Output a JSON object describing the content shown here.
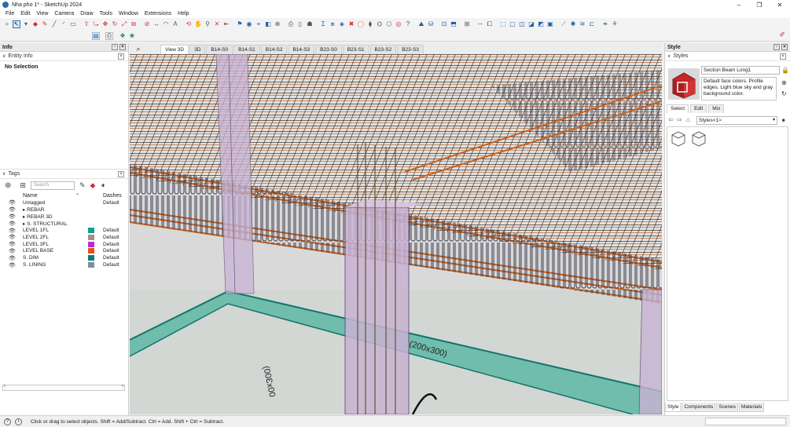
{
  "window": {
    "title": "Nha pho 1* - SketchUp 2024",
    "minimize": "–",
    "restore": "❐",
    "close": "✕"
  },
  "menu": [
    "File",
    "Edit",
    "View",
    "Camera",
    "Draw",
    "Tools",
    "Window",
    "Extensions",
    "Help"
  ],
  "left_panel": {
    "title": "Info",
    "entity_info": {
      "header": "Entity Info",
      "value": "No Selection"
    },
    "tags": {
      "header": "Tags",
      "search_placeholder": "Search",
      "col_name": "Name",
      "col_dashes": "Dashes",
      "rows": [
        {
          "name": "Untagged",
          "dash": "Default",
          "color": ""
        },
        {
          "name": "▸ REBAR",
          "dash": "",
          "color": ""
        },
        {
          "name": "▸ REBAR 3D",
          "dash": "",
          "color": ""
        },
        {
          "name": "▸ S. STRUCTURAL",
          "dash": "",
          "color": ""
        },
        {
          "name": "LEVEL 1FL",
          "dash": "Default",
          "color": "#14a08c"
        },
        {
          "name": "LEVEL 2FL",
          "dash": "Default",
          "color": "#a88b8b"
        },
        {
          "name": "LEVEL 3FL",
          "dash": "Default",
          "color": "#b52cde"
        },
        {
          "name": "LEVEL BASE",
          "dash": "Default",
          "color": "#e2531c"
        },
        {
          "name": "S. DIM",
          "dash": "Default",
          "color": "#117a7a"
        },
        {
          "name": "S. LINING",
          "dash": "Default",
          "color": "#7c8fa3"
        }
      ]
    }
  },
  "scene_tabs": [
    "View 3D",
    "3D",
    "B14-S0",
    "B14-S1",
    "B14-S2",
    "B14-S3",
    "B23-S0",
    "B23-S1",
    "B23-S2",
    "B23-S3"
  ],
  "viewport": {
    "dim_label_1": "(200x300)",
    "dim_label_2": "(00Ɛx00"
  },
  "right_panel": {
    "title": "Style",
    "styles_header": "Styles",
    "style_name": "Section Beam Long1",
    "style_desc": "Default face colors. Profile edges. Light blue sky and gray background color.",
    "tabs": [
      "Select",
      "Edit",
      "Mix"
    ],
    "styles_dropdown": "Styles<1>",
    "bottom_tabs": [
      "Style",
      "Components",
      "Scenes",
      "Materials"
    ]
  },
  "status": {
    "text": "Click or drag to select objects. Shift = Add/Subtract. Ctrl = Add. Shift + Ctrl = Subtract."
  },
  "colors": {
    "rebar": "#c8621e",
    "column": "#c9b3d4",
    "slab_edge": "#13736c",
    "grid_line": "#3a2a1c"
  }
}
